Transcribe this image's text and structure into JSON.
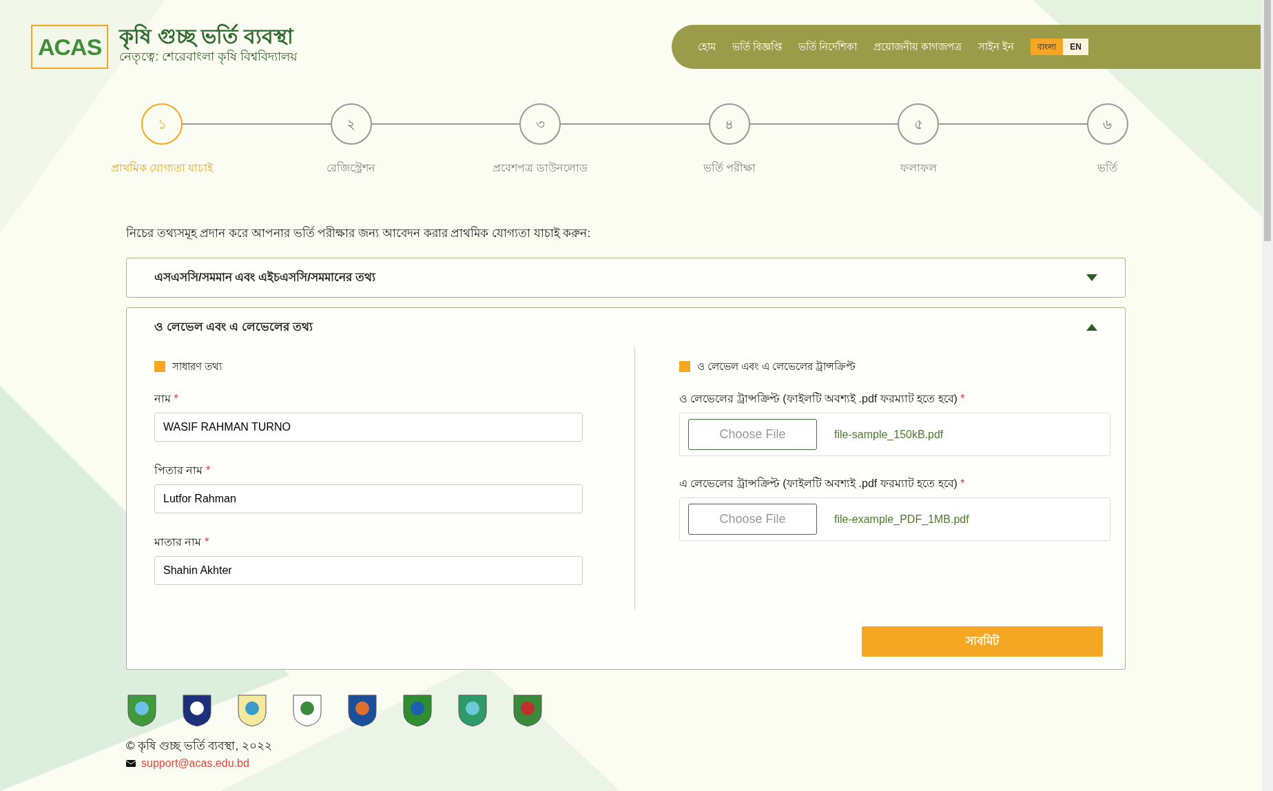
{
  "header": {
    "logo": "ACAS",
    "title": "কৃষি গুচ্ছ ভর্তি ব্যবস্থা",
    "subtitle": "নেতৃত্বে: শেরেবাংলা কৃষি বিশ্ববিদ্যালয়"
  },
  "nav": {
    "links": [
      "হোম",
      "ভর্তি বিজ্ঞপ্তি",
      "ভর্তি নির্দেশিকা",
      "প্রয়োজনীয় কাগজপত্র",
      "সাইন ইন"
    ],
    "languages": [
      {
        "label": "বাংলা",
        "selected": true
      },
      {
        "label": "EN",
        "selected": false
      }
    ]
  },
  "steps": [
    {
      "number": "১",
      "label": "প্রাথমিক যোগ্যতা যাচাই",
      "selected": true
    },
    {
      "number": "২",
      "label": "রেজিস্ট্রেশন",
      "selected": false
    },
    {
      "number": "৩",
      "label": "প্রবেশপত্র ডাউনলোড",
      "selected": false
    },
    {
      "number": "৪",
      "label": "ভর্তি পরীক্ষা",
      "selected": false
    },
    {
      "number": "৫",
      "label": "ফলাফল",
      "selected": false
    },
    {
      "number": "৬",
      "label": "ভর্তি",
      "selected": false
    }
  ],
  "intro": "নিচের তথ্যসমূহ প্রদান করে আপনার ভর্তি পরীক্ষার জন্য আবেদন করার প্রাথমিক যোগ্যতা যাচাই করুন:",
  "sections": [
    {
      "title": "এসএসসি/সমমান এবং এইচএসসি/সমমানের তথ্য",
      "expanded": false
    },
    {
      "title": "ও লেভেল এবং এ লেভেলের তথ্য",
      "expanded": true,
      "left": {
        "heading": "সাধারণ তথ্য",
        "fields": [
          {
            "label": "নাম",
            "required": "*",
            "value": "WASIF RAHMAN TURNO"
          },
          {
            "label": "পিতার নাম",
            "required": "*",
            "value": "Lutfor Rahman"
          },
          {
            "label": "মাতার নাম",
            "required": "*",
            "value": "Shahin Akhter"
          }
        ]
      },
      "right": {
        "heading": "ও লেভেল এবং এ লেভেলের ট্রান্সক্রিপ্ট",
        "files": [
          {
            "label": "ও লেভেলের ট্রান্সক্রিপ্ট (ফাইলটি অবশ্যই .pdf ফরম্যাট হতে হবে)",
            "required": "*",
            "button": "Choose File",
            "filename": "file-sample_150kB.pdf"
          },
          {
            "label": "এ লেভেলের ট্রান্সক্রিপ্ট (ফাইলটি অবশ্যই .pdf ফরম্যাট হতে হবে)",
            "required": "*",
            "button": "Choose File",
            "filename": "file-example_PDF_1MB.pdf"
          }
        ]
      },
      "submit": "সাবমিট"
    }
  ],
  "footer": {
    "copyright": "© কৃষি গুচ্ছ ভর্তি ব্যবস্থা, ২০২২",
    "email": "support@acas.edu.bd"
  }
}
